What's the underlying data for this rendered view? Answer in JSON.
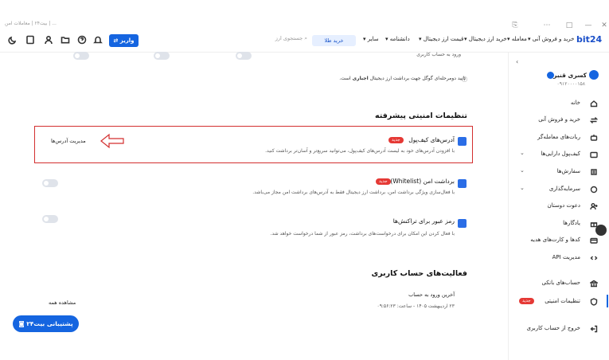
{
  "browser": {
    "tab_title": "بیت۲۴ | معاملات امن | ...",
    "window_buttons": [
      "⋯",
      "□",
      "—",
      "✕"
    ]
  },
  "header": {
    "logo": "bit24",
    "nav": [
      "خرید و فروش آنی",
      "معامله",
      "خرید ارز دیجیتال",
      "قیمت ارز دیجیتال",
      "دانشنامه",
      "سایر"
    ],
    "buy_button": "خرید طلا",
    "search_placeholder": "جستجوی ارز",
    "deposit_button": "واریز"
  },
  "sidebar": {
    "user_name": "کسری قنبری",
    "user_id": "۰۹۱۲۰۰۰۰۱۵۸",
    "items": [
      {
        "label": "خانه",
        "icon": "home-icon"
      },
      {
        "label": "خرید و فروش آنی",
        "icon": "swap-icon"
      },
      {
        "label": "ربات‌های معامله‌گر",
        "icon": "robot-icon"
      },
      {
        "label": "کیف‌پول دارایی‌ها",
        "icon": "wallet-icon"
      },
      {
        "label": "سفارش‌ها",
        "icon": "orders-icon"
      },
      {
        "label": "سرمایه‌گذاری",
        "icon": "investment-icon"
      },
      {
        "label": "دعوت دوستان",
        "icon": "invite-icon"
      },
      {
        "label": "یادگارها",
        "icon": "gift-icon"
      },
      {
        "label": "کدها و کارت‌های هدیه",
        "icon": "card-icon"
      },
      {
        "label": "مدیریت API",
        "icon": "code-icon"
      },
      {
        "label": "حساب‌های بانکی",
        "icon": "bank-icon"
      },
      {
        "label": "تنظیمات امنیتی",
        "icon": "shield-icon",
        "badge": "جدید"
      },
      {
        "label": "خروج از حساب کاربری",
        "icon": "logout-icon"
      }
    ]
  },
  "main": {
    "top_row_text": "ورود به حساب کاربری",
    "twofa_note": "تایید دومرحله‌ای گوگل جهت برداشت ارز دیجیتال",
    "twofa_emph": "اجباری",
    "twofa_suffix": "است.",
    "advanced_title": "تنظیمات امنیتی پیشرفته",
    "wallet": {
      "title": "آدرس‌های کیف‌پول",
      "badge": "جدید",
      "desc": "با افزودن آدرس‌های خود به لیست آدرس‌های کیف‌پول، می‌توانید سریع‌تر و آسان‌تر برداشت کنید.",
      "manage": "مدیریت آدرس‌ها"
    },
    "whitelist": {
      "title": "برداشت امن (Whitelist)",
      "badge": "جدید",
      "desc": "با فعال‌سازی ویژگی برداشت امن، برداشت ارز دیجیتال فقط به آدرس‌های برداشت امن مجاز می‌باشد."
    },
    "txpass": {
      "title": "رمز عبور برای تراکنش‌ها",
      "desc": "با فعال کردن این امکان برای درخواست‌های برداشت، رمز عبور از شما درخواست خواهد شد."
    },
    "activity_title": "فعالیت‌های حساب کاربری",
    "last_login_label": "آخرین ورود به حساب",
    "last_login_value": "۲۳ اردیبهشت ۱۴۰۵ - ساعت: ۰۹:۵۶:۲۳",
    "see_all": "مشاهده همه",
    "support": "پشتیبانی بیت۲۴"
  }
}
